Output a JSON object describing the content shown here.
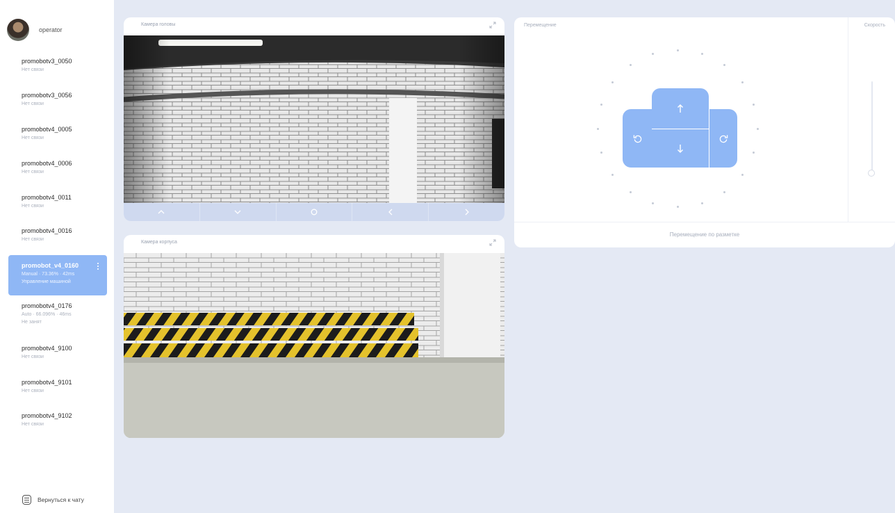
{
  "user": {
    "name": "operator"
  },
  "robots": [
    {
      "name": "promobotv3_0050",
      "status": "Нет связи"
    },
    {
      "name": "promobotv3_0056",
      "status": "Нет связи"
    },
    {
      "name": "promobotv4_0005",
      "status": "Нет связи"
    },
    {
      "name": "promobotv4_0006",
      "status": "Нет связи"
    },
    {
      "name": "promobotv4_0011",
      "status": "Нет связи"
    },
    {
      "name": "promobotv4_0016",
      "status": "Нет связи"
    },
    {
      "name": "promobot_v4_0160",
      "status": "Manual · 73.36% · 42ms",
      "status2": "Управление машиной",
      "active": true
    },
    {
      "name": "promobotv4_0176",
      "status": "Auto · 66.096% · 46ms",
      "status2": "Не занят"
    },
    {
      "name": "promobotv4_9100",
      "status": "Нет связи"
    },
    {
      "name": "promobotv4_9101",
      "status": "Нет связи"
    },
    {
      "name": "promobotv4_9102",
      "status": "Нет связи"
    }
  ],
  "logout": {
    "label": "Вернуться к чату"
  },
  "camera_head": {
    "title": "Камера головы"
  },
  "camera_body": {
    "title": "Камера корпуса"
  },
  "movement": {
    "title": "Перемещение",
    "speed_title": "Скорость",
    "footer": "Перемещение по разметке"
  },
  "speed": {
    "level": 0.0
  },
  "icons": {
    "expand": "expand-icon",
    "cam_up": "chevron-up-icon",
    "cam_down": "chevron-down-icon",
    "cam_center": "circle-icon",
    "cam_left": "chevron-left-icon",
    "cam_right": "chevron-right-icon",
    "forward": "arrow-up-icon",
    "backward": "arrow-down-icon",
    "rotate_left": "rotate-left-icon",
    "rotate_right": "rotate-right-icon"
  },
  "colors": {
    "accent": "#8fb7f5",
    "background": "#e4e9f4",
    "panel": "#ffffff"
  }
}
